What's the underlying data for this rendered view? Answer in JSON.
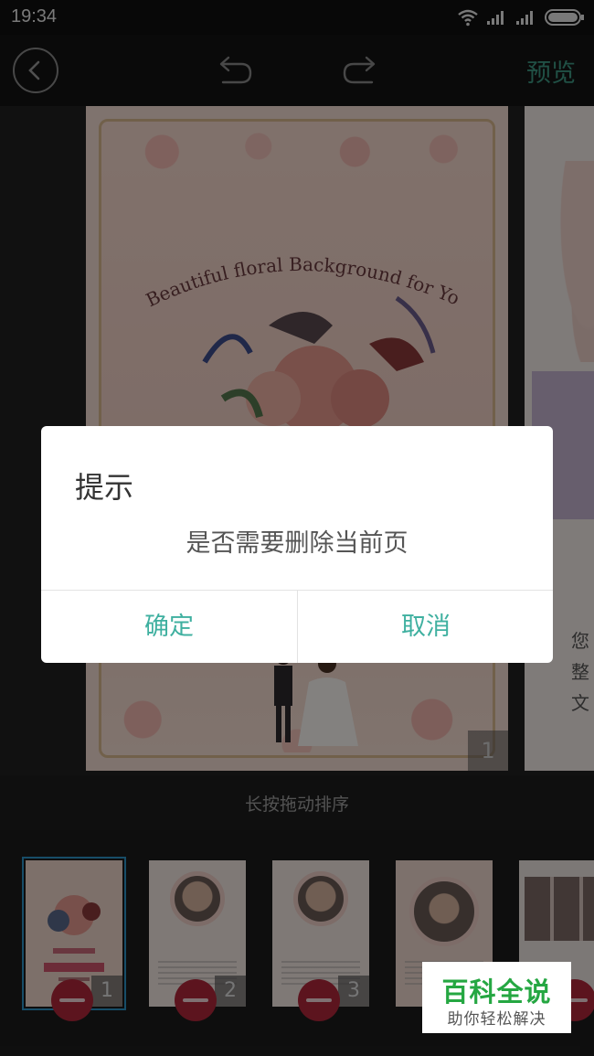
{
  "status_bar": {
    "time": "19:34"
  },
  "toolbar": {
    "preview_label": "预览"
  },
  "editor": {
    "page_card_text": "Beautiful floral Background for Your Design",
    "current_page_number": "1",
    "side_text": [
      "您",
      "整",
      "文"
    ]
  },
  "dialog": {
    "title": "提示",
    "message": "是否需要删除当前页",
    "confirm_label": "确定",
    "cancel_label": "取消"
  },
  "hint": {
    "text": "长按拖动排序"
  },
  "thumbnails": [
    {
      "number": "1"
    },
    {
      "number": "2"
    },
    {
      "number": "3"
    },
    {
      "number": ""
    },
    {
      "number": ""
    }
  ],
  "watermark": {
    "title": "百科全说",
    "subtitle": "助你轻松解决"
  },
  "colors": {
    "accent": "#3fb0a0",
    "delete": "#b0283a",
    "selected_outline": "#2d95c7",
    "preview": "#3e9a84"
  }
}
